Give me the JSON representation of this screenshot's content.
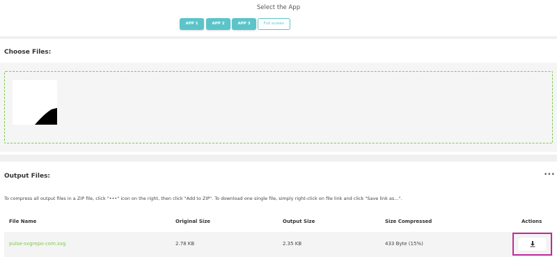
{
  "app_select": {
    "label": "Select the App",
    "buttons": [
      "APP 1",
      "APP 2",
      "APP 3"
    ],
    "fullscreen_label": "Full screen"
  },
  "choose": {
    "title": "Choose Files:"
  },
  "output": {
    "title": "Output Files:",
    "more_icon": "•••",
    "info": "To compress all output files in a ZIP file, click \"•••\" icon on the right, then click \"Add to ZIP\". To download one single file, simply right-click on file link and click \"Save link as...\"."
  },
  "table": {
    "headers": {
      "file_name": "File Name",
      "original_size": "Original Size",
      "output_size": "Output Size",
      "size_compressed": "Size Compressed",
      "actions": "Actions"
    },
    "rows": [
      {
        "file_name": "pulse-svgrepo-com.svg",
        "original_size": "2.78 KB",
        "output_size": "2.35 KB",
        "size_compressed": "433 Byte (15%)"
      }
    ]
  },
  "colors": {
    "accent": "#5bc4c9",
    "link": "#7cc94a",
    "highlight": "#c2279c"
  },
  "icons": {
    "download": "download-icon",
    "more": "more-dots-icon"
  }
}
